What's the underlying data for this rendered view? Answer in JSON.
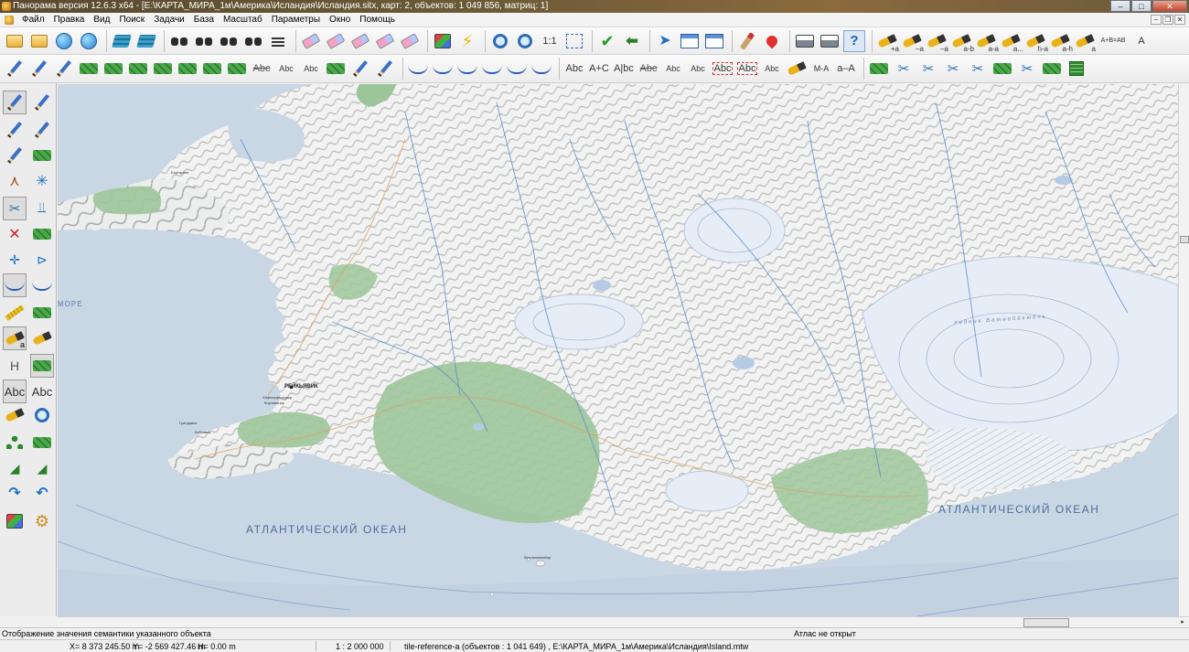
{
  "window": {
    "title": "Панорама версия 12.6.3 x64 - [E:\\КАРТА_МИРА_1м\\Америка\\Исландия\\Исландия.sitx, карт: 2, объектов: 1 049 856, матриц: 1]",
    "minimize": "–",
    "maximize": "□",
    "close": "✕"
  },
  "menu": {
    "items": [
      "Файл",
      "Правка",
      "Вид",
      "Поиск",
      "Задачи",
      "База",
      "Масштаб",
      "Параметры",
      "Окно",
      "Помощь"
    ],
    "mdi_controls": [
      "–",
      "❐",
      "✕"
    ]
  },
  "toolbar1": {
    "zoom_1to1": "1:1",
    "text_buttons": [
      "+a",
      "–a",
      "–a",
      "a-b",
      "a-a",
      "a...",
      "h-a",
      "a-h",
      "a",
      "A+B=AB",
      "A"
    ]
  },
  "toolbar2": {
    "text_buttons": [
      "Abc",
      "Abc",
      "Abc",
      "Abc",
      "A+C",
      "A|bc",
      "Abc",
      "Abc",
      "Abc",
      "Abc",
      "Abc",
      "Abc",
      "M-A",
      "a–A"
    ]
  },
  "left_panel": {
    "text_buttons": [
      "H",
      "Abc",
      "Abc",
      "a"
    ]
  },
  "map": {
    "ocean_labels": [
      "АТЛАНТИЧЕСКИЙ ОКЕАН",
      "АТЛАНТИЧЕСКИЙ ОКЕАН"
    ],
    "sea_label": "МОРЕ",
    "capital_label": "РЕЙКЬЯВИК",
    "glacier_label": "ледник Ватнайёкюдль",
    "small_labels": [
      "Гриндавик",
      "Кеблавик",
      "Хафнарфьордюр",
      "Коупавогюр",
      "Вестманнаэйяр",
      "Боргарнес"
    ],
    "colors": {
      "ocean": "#c9d6e4",
      "land": "#f1f2f1",
      "relief_shadow": "#a7aaa8",
      "forest": "#9dc59a",
      "glacier": "#e6edf6",
      "river": "#5b8cc9"
    }
  },
  "scrollbars": {
    "right_arrow": "▸"
  },
  "status": {
    "hint": "Отображение значения семантики указанного объекта",
    "atlas": "Атлас не открыт",
    "x": "X= 8 373 245.50 m",
    "y": "Y= -2 569 427.46 m",
    "h": "H=   0.00 m",
    "scale": "1 : 2 000 000",
    "object": "tile-reference-a   (объектов : 1 041 649)  , E:\\КАРТА_МИРА_1м\\Америка\\Исландия\\Island.mtw"
  }
}
